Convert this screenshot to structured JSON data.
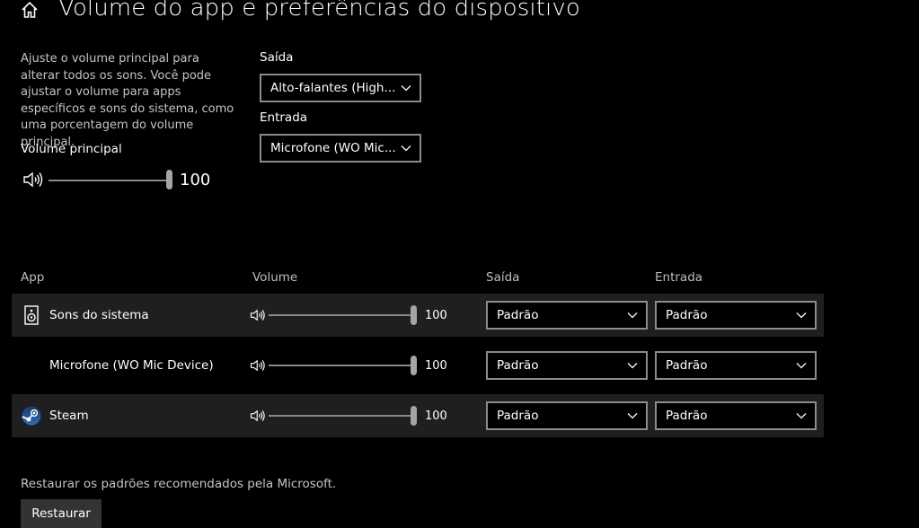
{
  "header": {
    "title": "Volume do app e preferências do dispositivo",
    "home_icon": "home-icon"
  },
  "master": {
    "description": "Ajuste o volume principal para alterar todos os sons. Você pode ajustar o volume para apps específicos e sons do sistema, como uma porcentagem do volume principal.",
    "volume_label": "Volume principal",
    "volume_value": "100",
    "volume_level": 100
  },
  "output": {
    "label": "Saída",
    "selected": "Alto-falantes (High..."
  },
  "input": {
    "label": "Entrada",
    "selected": "Microfone (WO Mic..."
  },
  "table": {
    "headers": {
      "app": "App",
      "volume": "Volume",
      "output": "Saída",
      "input": "Entrada"
    },
    "rows": [
      {
        "name": "Sons do sistema",
        "icon": "speaker-device-icon",
        "volume": "100",
        "output": "Padrão",
        "input": "Padrão"
      },
      {
        "name": "Microfone (WO Mic Device)",
        "icon": "",
        "volume": "100",
        "output": "Padrão",
        "input": "Padrão"
      },
      {
        "name": "Steam",
        "icon": "steam-icon",
        "volume": "100",
        "output": "Padrão",
        "input": "Padrão"
      }
    ]
  },
  "restore": {
    "text": "Restaurar os padrões recomendados pela Microsoft.",
    "button_label": "Restaurar"
  },
  "colors": {
    "background": "#000000",
    "row_highlight": "#1f1f1f",
    "border": "#8c8c8c",
    "button": "#333333"
  }
}
